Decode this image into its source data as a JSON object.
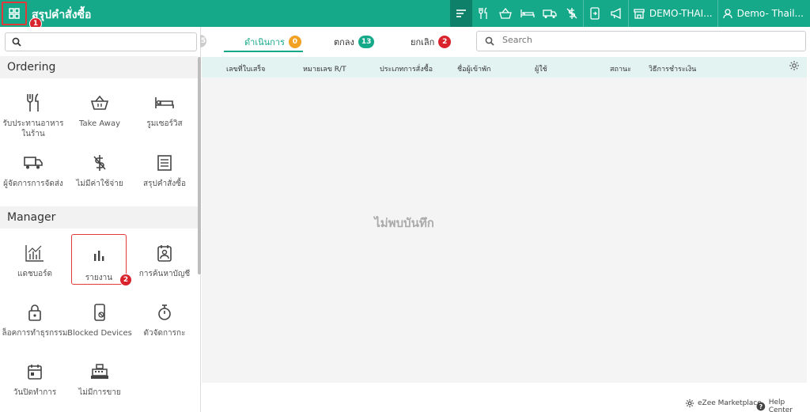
{
  "header": {
    "title": "สรุปคำสั่งซื้อ",
    "menu_badge": "1",
    "property_label": "DEMO-THAI...",
    "user_label": "Demo- Thail..."
  },
  "sidebar": {
    "search_placeholder": "",
    "sections": [
      {
        "title": "Ordering",
        "items": [
          {
            "label": "รับประทานอาหารในร้าน",
            "icon": "fork-knife-icon"
          },
          {
            "label": "Take Away",
            "icon": "basket-icon"
          },
          {
            "label": "รูมเซอร์วิส",
            "icon": "bed-icon"
          },
          {
            "label": "ผู้จัดการการจัดส่ง",
            "icon": "truck-icon"
          },
          {
            "label": "ไม่มีค่าใช้จ่าย",
            "icon": "no-charge-icon"
          },
          {
            "label": "สรุปคำสั่งซื้อ",
            "icon": "list-icon"
          }
        ]
      },
      {
        "title": "Manager",
        "items": [
          {
            "label": "แดชบอร์ด",
            "icon": "dashboard-chart-icon"
          },
          {
            "label": "รายงาน",
            "icon": "bar-chart-icon",
            "badge": "2"
          },
          {
            "label": "การค้นหาบัญชี",
            "icon": "account-lookup-icon"
          },
          {
            "label": "ล็อคการทำธุรกรรม",
            "icon": "lock-icon"
          },
          {
            "label": "Blocked Devices",
            "icon": "blocked-device-icon"
          },
          {
            "label": "ตัวจัดการกะ",
            "icon": "stopwatch-icon"
          },
          {
            "label": "วันปิดทำการ",
            "icon": "calendar-icon"
          },
          {
            "label": "ไม่มีการขาย",
            "icon": "cash-register-icon"
          }
        ]
      }
    ]
  },
  "tabs": [
    {
      "label": "ดำเนินการ",
      "count": "0",
      "color": "#f2a122"
    },
    {
      "label": "ตกลง",
      "count": "13",
      "color": "#15a98a"
    },
    {
      "label": "ยกเลิก",
      "count": "2",
      "color": "#d9232d"
    }
  ],
  "hidden_tab_count": "5",
  "search": {
    "placeholder": "Search"
  },
  "table": {
    "columns": [
      "เลขที่ใบเสร็จ",
      "หมายเลข R/T",
      "ประเภทการสั่งซื้อ",
      "ชื่อผู้เข้าพัก",
      "ผู้ใช้",
      "สถานะ",
      "วิธีการชำระเงิน"
    ],
    "empty_message": "ไม่พบบันทึก"
  },
  "footer": {
    "marketplace": "eZee Marketplace",
    "help": "Help Center"
  },
  "colors": {
    "primary": "#15a98a",
    "primary_dark": "#0e7f68",
    "highlight_red": "#e23a3a"
  }
}
